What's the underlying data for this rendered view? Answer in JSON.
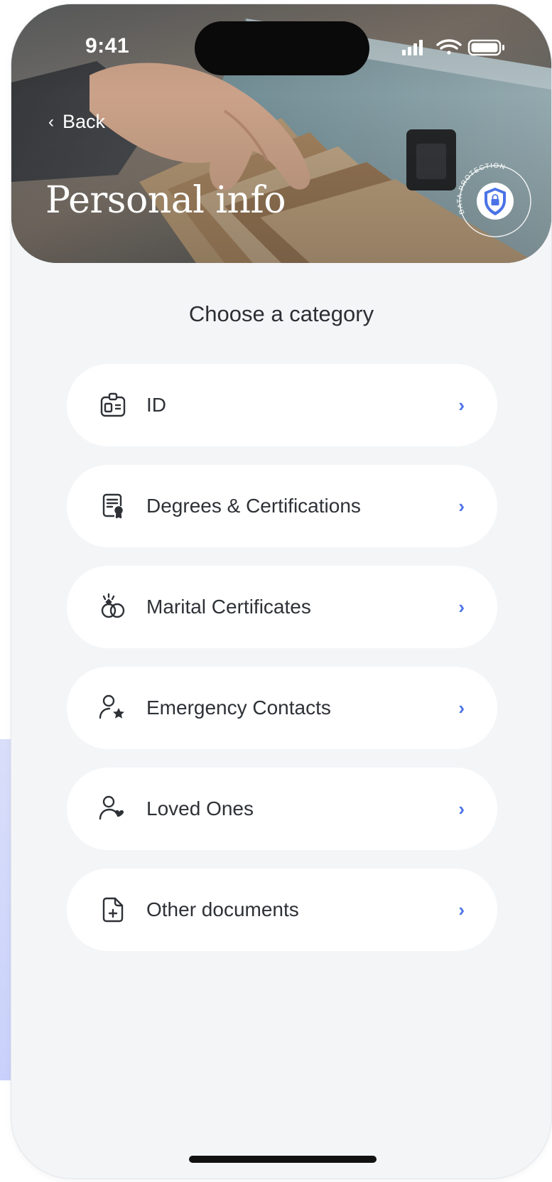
{
  "status_bar": {
    "time": "9:41"
  },
  "header": {
    "back_label": "Back",
    "back_chevron": "‹",
    "title": "Personal info",
    "badge_text": "DATA PROTECTION"
  },
  "subtitle": "Choose a category",
  "categories": [
    {
      "label": "ID",
      "icon": "id-card-icon",
      "arrow": "›"
    },
    {
      "label": "Degrees & Certifications",
      "icon": "certificate-icon",
      "arrow": "›"
    },
    {
      "label": "Marital Certificates",
      "icon": "rings-icon",
      "arrow": "›"
    },
    {
      "label": "Emergency Contacts",
      "icon": "user-star-icon",
      "arrow": "›"
    },
    {
      "label": "Loved Ones",
      "icon": "user-heart-icon",
      "arrow": "›"
    },
    {
      "label": "Other documents",
      "icon": "document-plus-icon",
      "arrow": "›"
    }
  ],
  "colors": {
    "accent": "#4b73e6",
    "background": "#f3f5f7",
    "card": "#ffffff",
    "text": "#2e3136"
  }
}
